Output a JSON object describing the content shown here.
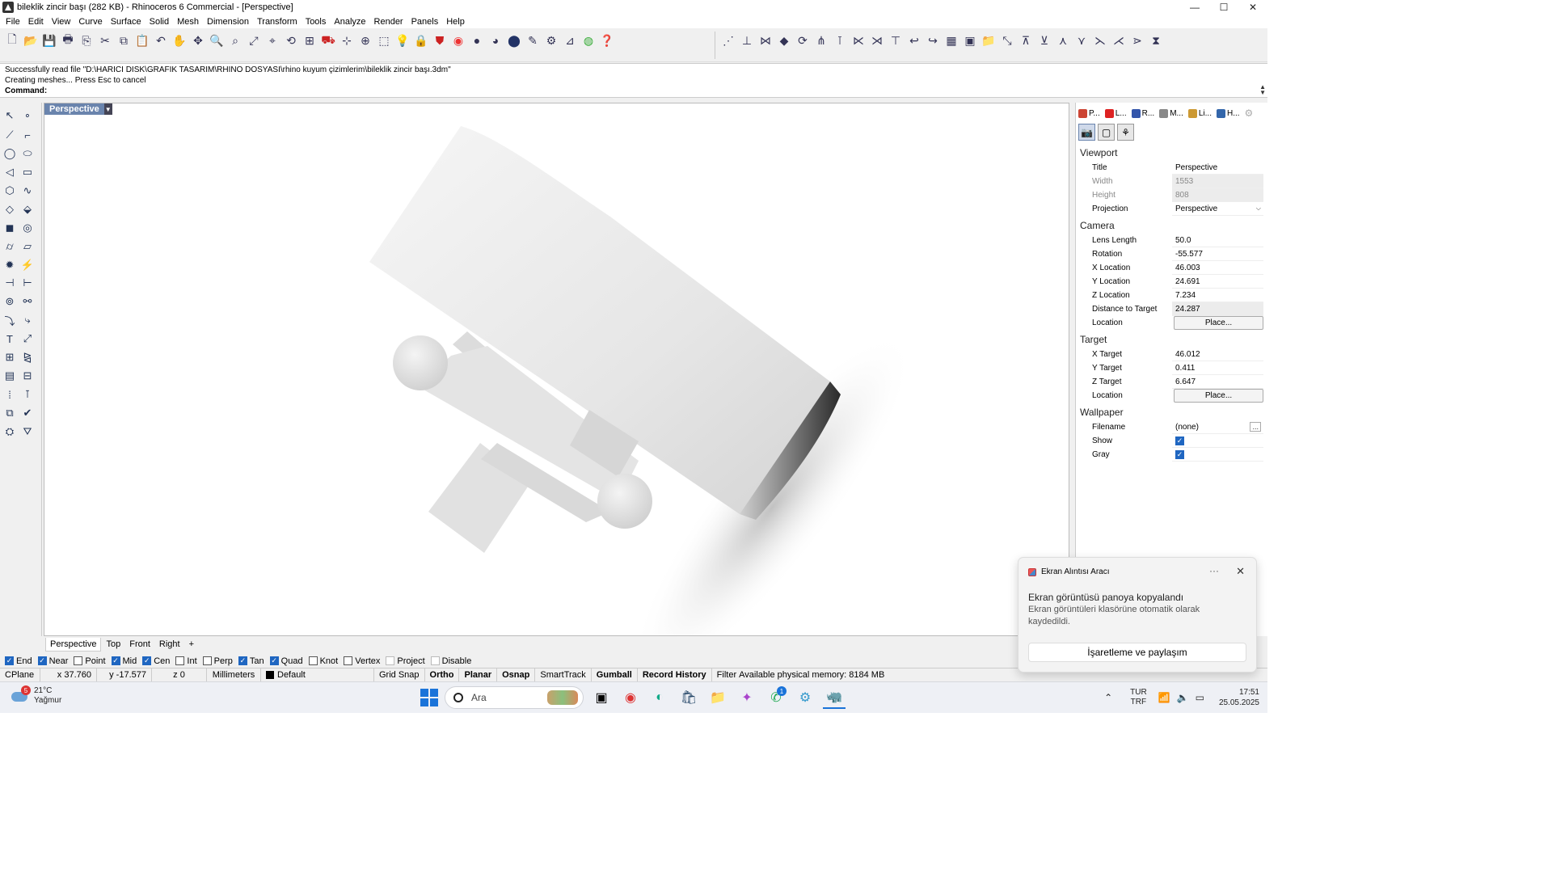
{
  "window": {
    "title": "bileklik zincir başı (282 KB) - Rhinoceros 6 Commercial - [Perspective]",
    "min": "—",
    "max": "☐",
    "close": "✕"
  },
  "menu": [
    "File",
    "Edit",
    "View",
    "Curve",
    "Surface",
    "Solid",
    "Mesh",
    "Dimension",
    "Transform",
    "Tools",
    "Analyze",
    "Render",
    "Panels",
    "Help"
  ],
  "command": {
    "line1": "Successfully read file \"D:\\HARICI DISK\\GRAFIK TASARIM\\RHINO DOSYASI\\rhino kuyum çizimlerim\\bileklik zincir başı.3dm\"",
    "line2": "Creating meshes... Press Esc to cancel",
    "prompt": "Command:"
  },
  "viewport": {
    "label": "Perspective",
    "tabs": [
      "Perspective",
      "Top",
      "Front",
      "Right"
    ],
    "active_tab": "Perspective",
    "add_tab": "+"
  },
  "osnap": [
    {
      "label": "End",
      "checked": true
    },
    {
      "label": "Near",
      "checked": true
    },
    {
      "label": "Point",
      "checked": false
    },
    {
      "label": "Mid",
      "checked": true
    },
    {
      "label": "Cen",
      "checked": true
    },
    {
      "label": "Int",
      "checked": false
    },
    {
      "label": "Perp",
      "checked": false
    },
    {
      "label": "Tan",
      "checked": true
    },
    {
      "label": "Quad",
      "checked": true
    },
    {
      "label": "Knot",
      "checked": false
    },
    {
      "label": "Vertex",
      "checked": false
    },
    {
      "label": "Project",
      "checked": false
    },
    {
      "label": "Disable",
      "checked": false
    }
  ],
  "status": {
    "cplane": "CPlane",
    "x": "x 37.760",
    "y": "y -17.577",
    "z": "z 0",
    "units": "Millimeters",
    "layer": "Default",
    "grid_snap": "Grid Snap",
    "ortho": "Ortho",
    "planar": "Planar",
    "osnap": "Osnap",
    "smarttrack": "SmartTrack",
    "gumball": "Gumball",
    "record_history": "Record History",
    "filter": "Filter",
    "memory": "Available physical memory: 8184 MB"
  },
  "panel": {
    "tabs": [
      {
        "label": "P...",
        "color": "#c43"
      },
      {
        "label": "L...",
        "color": "#d22"
      },
      {
        "label": "R...",
        "color": "#35a"
      },
      {
        "label": "M...",
        "color": "#888"
      },
      {
        "label": "Li...",
        "color": "#c93"
      },
      {
        "label": "H...",
        "color": "#36a"
      }
    ],
    "sections": {
      "viewport": "Viewport",
      "camera": "Camera",
      "target": "Target",
      "wallpaper": "Wallpaper"
    },
    "viewport": {
      "title_k": "Title",
      "title_v": "Perspective",
      "width_k": "Width",
      "width_v": "1553",
      "height_k": "Height",
      "height_v": "808",
      "projection_k": "Projection",
      "projection_v": "Perspective"
    },
    "camera": {
      "lens_k": "Lens Length",
      "lens_v": "50.0",
      "rot_k": "Rotation",
      "rot_v": "-55.577",
      "xloc_k": "X Location",
      "xloc_v": "46.003",
      "yloc_k": "Y Location",
      "yloc_v": "24.691",
      "zloc_k": "Z Location",
      "zloc_v": "7.234",
      "dist_k": "Distance to Target",
      "dist_v": "24.287",
      "loc_k": "Location",
      "loc_btn": "Place..."
    },
    "target": {
      "x_k": "X Target",
      "x_v": "46.012",
      "y_k": "Y Target",
      "y_v": "0.411",
      "z_k": "Z Target",
      "z_v": "6.647",
      "loc_k": "Location",
      "loc_btn": "Place..."
    },
    "wallpaper": {
      "file_k": "Filename",
      "file_v": "(none)",
      "file_btn": "...",
      "show_k": "Show",
      "show": true,
      "gray_k": "Gray",
      "gray": true
    }
  },
  "toast": {
    "app": "Ekran Alıntısı Aracı",
    "dots": "···",
    "close": "✕",
    "title": "Ekran görüntüsü panoya kopyalandı",
    "body": "Ekran görüntüleri klasörüne otomatik olarak kaydedildi.",
    "button": "İşaretleme ve paylaşım"
  },
  "taskbar": {
    "weather_badge": "5",
    "temp": "21°C",
    "cond": "Yağmur",
    "search": "Ara",
    "whatsapp_badge": "1",
    "lang1": "TUR",
    "lang2": "TRF",
    "time": "17:51",
    "date": "25.05.2025"
  }
}
